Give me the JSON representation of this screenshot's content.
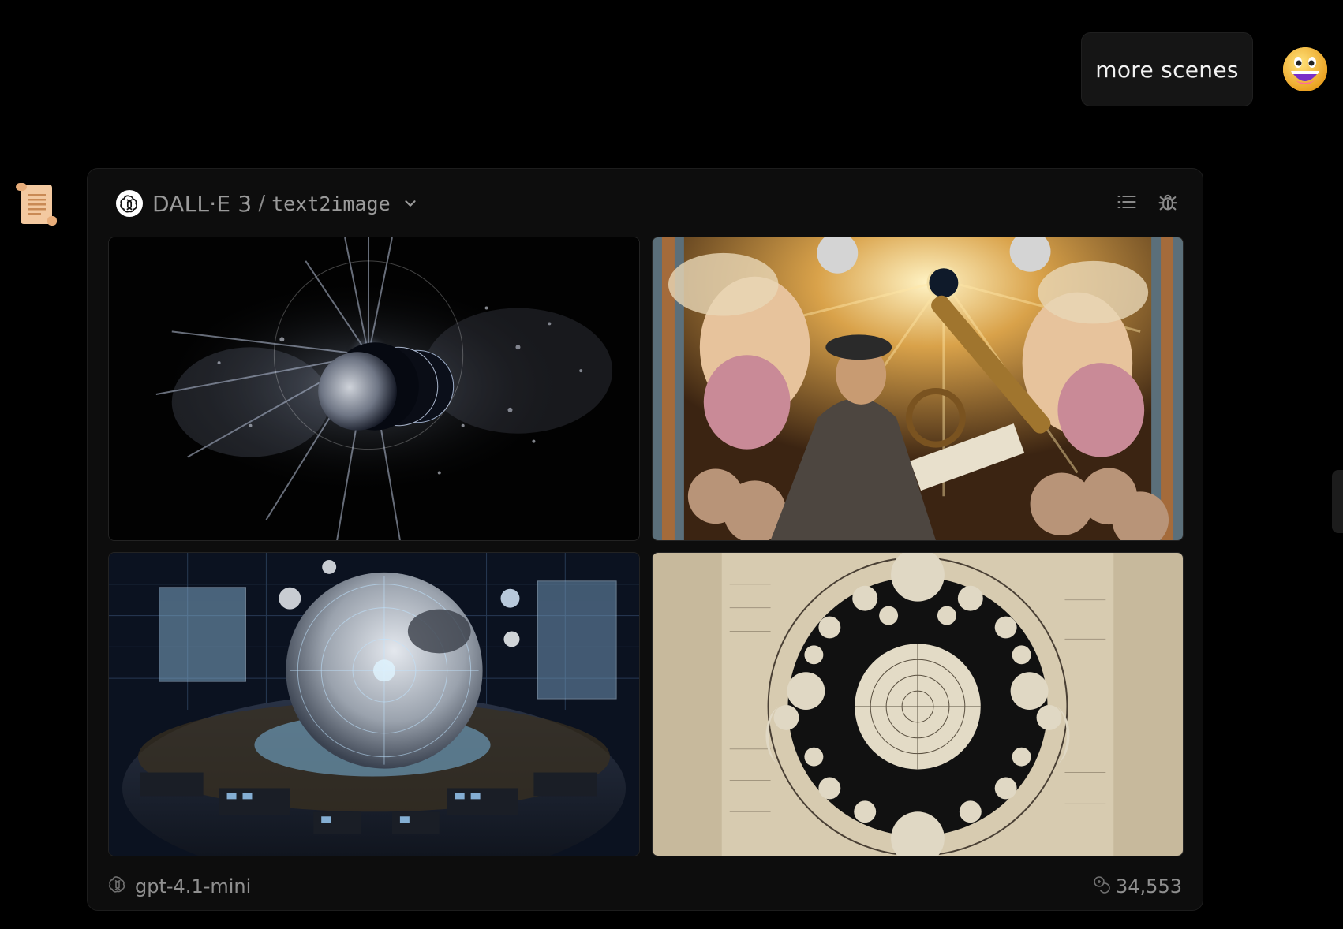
{
  "user_message": {
    "text": "more scenes",
    "avatar_icon": "grinning-face-icon"
  },
  "assistant": {
    "avatar_icon": "scroll-icon"
  },
  "plugin_card": {
    "plugin_name": "DALL·E 3",
    "separator": "/",
    "api_name": "text2image",
    "plugin_icon": "openai-logo-icon",
    "actions": [
      {
        "name": "list-icon"
      },
      {
        "name": "debug-bug-icon"
      }
    ],
    "images": [
      {
        "name": "generated-image-1",
        "subject": "moon eclipse light rays in space"
      },
      {
        "name": "generated-image-2",
        "subject": "renaissance astronomer with telescope and angels"
      },
      {
        "name": "generated-image-3",
        "subject": "futuristic lunar observation hall"
      },
      {
        "name": "generated-image-4",
        "subject": "antique moon phases chart"
      }
    ],
    "footer": {
      "model": "gpt-4.1-mini",
      "tokens": "34,553"
    }
  },
  "colors": {
    "background": "#000000",
    "card_bg": "#0d0d0d",
    "bubble_bg": "#151515",
    "muted_text": "#8f8f8f"
  }
}
